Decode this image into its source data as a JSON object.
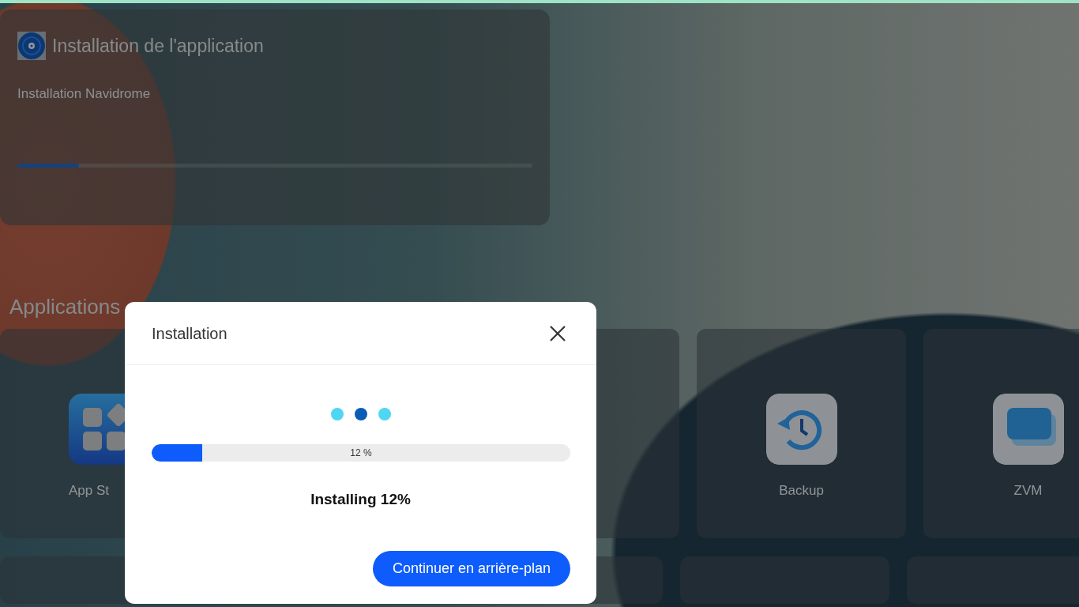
{
  "notification": {
    "title": "Installation de l'application",
    "message": "Installation Navidrome",
    "level": 0.12
  },
  "section_title": "Applications",
  "apps": [
    {
      "kind": "store",
      "label": "App St"
    },
    {
      "kind": "blank"
    },
    {
      "kind": "blank"
    },
    {
      "kind": "backup",
      "label": "Backup"
    },
    {
      "kind": "vm",
      "label": "ZVM"
    }
  ],
  "dialog": {
    "title": "Installation",
    "loading_dots": [
      {
        "color": "#4fd6f2"
      },
      {
        "color": "#0b5cb5"
      },
      {
        "color": "#4fd6f2"
      }
    ],
    "progress": {
      "level": 0.12,
      "reading": "12 %"
    },
    "status": "Installing 12%",
    "button": "Continuer en arrière-plan"
  }
}
